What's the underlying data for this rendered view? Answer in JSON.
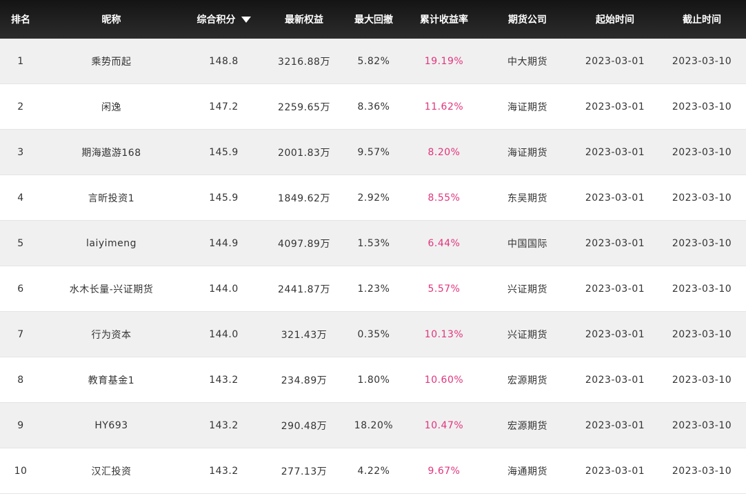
{
  "header": {
    "rank": "排名",
    "nickname": "昵称",
    "score": "综合积分",
    "equity": "最新权益",
    "max_drawdown": "最大回撤",
    "cum_return": "累计收益率",
    "company": "期货公司",
    "start": "起始时间",
    "end": "截止时间",
    "sort_icon": "triangle-down-icon"
  },
  "colors": {
    "header_bg": "#1a1a1a",
    "return_text": "#e2337c",
    "stripe": "#f0f0f0"
  },
  "rows": [
    {
      "rank": "1",
      "nickname": "乘势而起",
      "score": "148.8",
      "equity": "3216.88万",
      "max_drawdown": "5.82%",
      "cum_return": "19.19%",
      "company": "中大期货",
      "start": "2023-03-01",
      "end": "2023-03-10"
    },
    {
      "rank": "2",
      "nickname": "闲逸",
      "score": "147.2",
      "equity": "2259.65万",
      "max_drawdown": "8.36%",
      "cum_return": "11.62%",
      "company": "海证期货",
      "start": "2023-03-01",
      "end": "2023-03-10"
    },
    {
      "rank": "3",
      "nickname": "期海遨游168",
      "score": "145.9",
      "equity": "2001.83万",
      "max_drawdown": "9.57%",
      "cum_return": "8.20%",
      "company": "海证期货",
      "start": "2023-03-01",
      "end": "2023-03-10"
    },
    {
      "rank": "4",
      "nickname": "言昕投资1",
      "score": "145.9",
      "equity": "1849.62万",
      "max_drawdown": "2.92%",
      "cum_return": "8.55%",
      "company": "东吴期货",
      "start": "2023-03-01",
      "end": "2023-03-10"
    },
    {
      "rank": "5",
      "nickname": "laiyimeng",
      "score": "144.9",
      "equity": "4097.89万",
      "max_drawdown": "1.53%",
      "cum_return": "6.44%",
      "company": "中国国际",
      "start": "2023-03-01",
      "end": "2023-03-10"
    },
    {
      "rank": "6",
      "nickname": "水木长量-兴证期货",
      "score": "144.0",
      "equity": "2441.87万",
      "max_drawdown": "1.23%",
      "cum_return": "5.57%",
      "company": "兴证期货",
      "start": "2023-03-01",
      "end": "2023-03-10"
    },
    {
      "rank": "7",
      "nickname": "行为资本",
      "score": "144.0",
      "equity": "321.43万",
      "max_drawdown": "0.35%",
      "cum_return": "10.13%",
      "company": "兴证期货",
      "start": "2023-03-01",
      "end": "2023-03-10"
    },
    {
      "rank": "8",
      "nickname": "教育基金1",
      "score": "143.2",
      "equity": "234.89万",
      "max_drawdown": "1.80%",
      "cum_return": "10.60%",
      "company": "宏源期货",
      "start": "2023-03-01",
      "end": "2023-03-10"
    },
    {
      "rank": "9",
      "nickname": "HY693",
      "score": "143.2",
      "equity": "290.48万",
      "max_drawdown": "18.20%",
      "cum_return": "10.47%",
      "company": "宏源期货",
      "start": "2023-03-01",
      "end": "2023-03-10"
    },
    {
      "rank": "10",
      "nickname": "汉汇投资",
      "score": "143.2",
      "equity": "277.13万",
      "max_drawdown": "4.22%",
      "cum_return": "9.67%",
      "company": "海通期货",
      "start": "2023-03-01",
      "end": "2023-03-10"
    }
  ]
}
